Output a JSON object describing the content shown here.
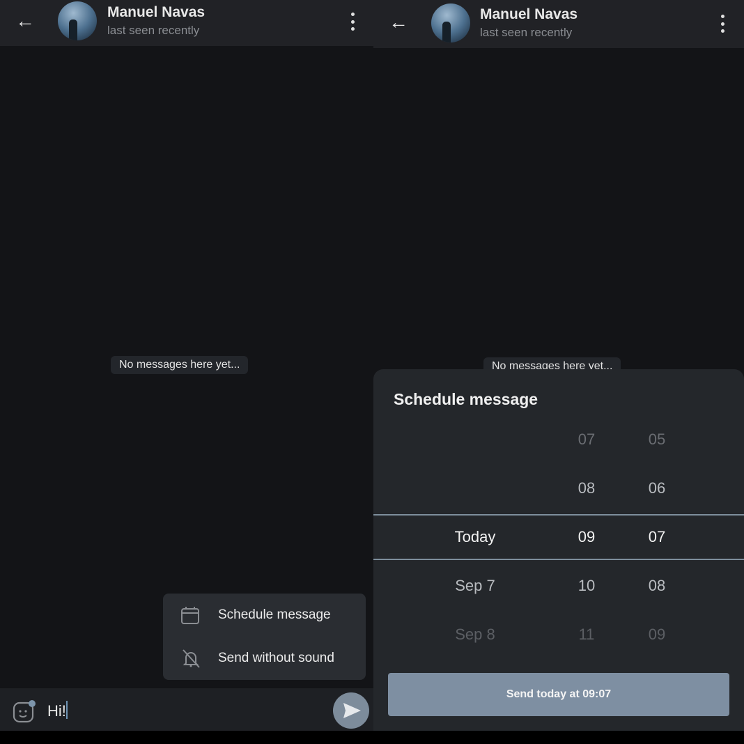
{
  "chat": {
    "contact_name": "Manuel Navas",
    "status": "last seen recently",
    "empty_text": "No messages here yet..."
  },
  "left": {
    "popup": {
      "items": [
        {
          "label": "Schedule message",
          "icon": "calendar-icon"
        },
        {
          "label": "Send without sound",
          "icon": "bell-off-icon"
        }
      ]
    },
    "input": {
      "value": "Hi!"
    }
  },
  "right": {
    "sheet": {
      "title": "Schedule message",
      "days": [
        "",
        "",
        "Today",
        "Sep 7",
        "Sep 8"
      ],
      "hours": [
        "07",
        "08",
        "09",
        "10",
        "11"
      ],
      "minutes": [
        "05",
        "06",
        "07",
        "08",
        "09"
      ],
      "selected": {
        "day": "Today",
        "hour": "09",
        "minute": "07"
      },
      "send_label": "Send today at 09:07"
    }
  },
  "colors": {
    "accent": "#7e8fa2",
    "background": "#131417",
    "header": "#212226",
    "sheet": "#24272b"
  }
}
